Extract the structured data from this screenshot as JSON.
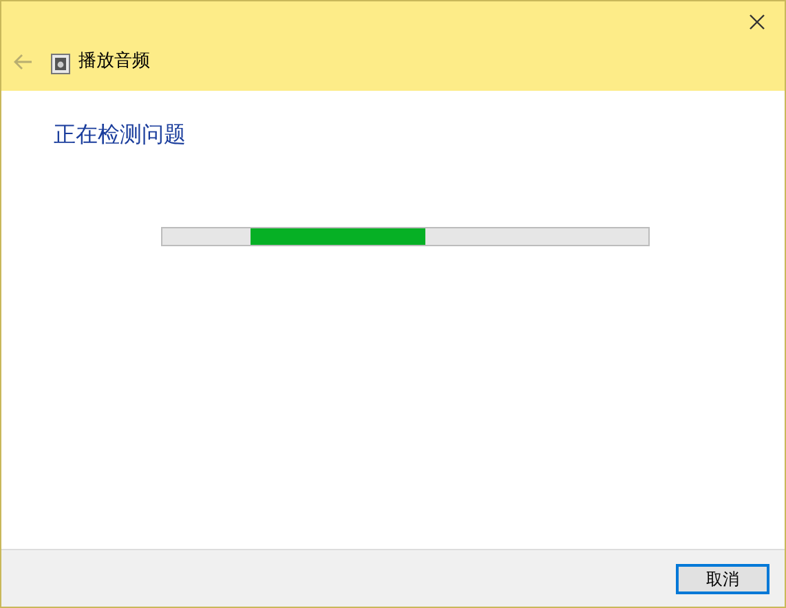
{
  "header": {
    "back_enabled": false,
    "title": "播放音频"
  },
  "heading": "正在检测问题",
  "progress": {
    "kind": "marquee",
    "level": 0.36
  },
  "buttons": [
    {
      "label": "取消",
      "default": true
    }
  ]
}
